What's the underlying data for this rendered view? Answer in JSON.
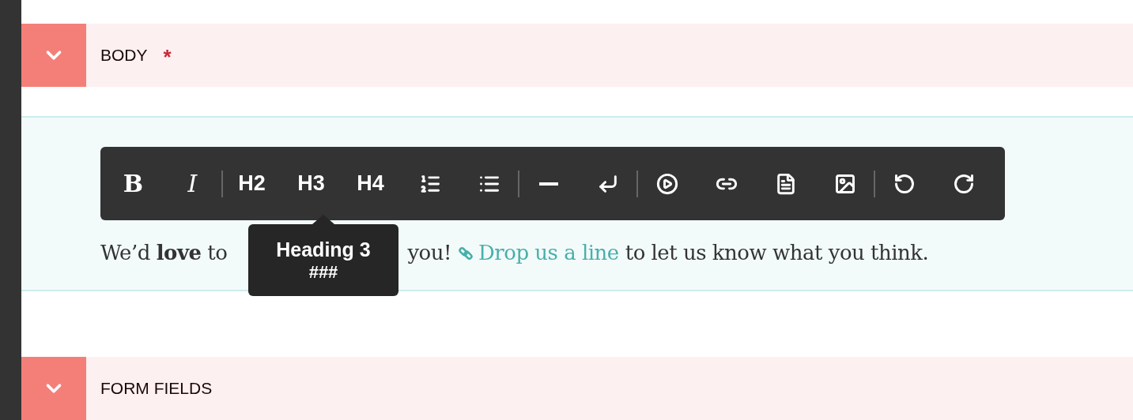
{
  "sections": [
    {
      "title": "BODY",
      "required_mark": "*",
      "expanded": true
    },
    {
      "title": "FORM FIELDS",
      "expanded": true
    }
  ],
  "toolbar": [
    {
      "kind": "bold",
      "label": "B"
    },
    {
      "kind": "italic",
      "label": "I"
    },
    {
      "kind": "separator"
    },
    {
      "kind": "heading",
      "label": "H2"
    },
    {
      "kind": "heading",
      "label": "H3"
    },
    {
      "kind": "heading",
      "label": "H4"
    },
    {
      "kind": "ordered-list"
    },
    {
      "kind": "bullet-list"
    },
    {
      "kind": "separator"
    },
    {
      "kind": "rule"
    },
    {
      "kind": "line-break"
    },
    {
      "kind": "separator"
    },
    {
      "kind": "video"
    },
    {
      "kind": "link"
    },
    {
      "kind": "document"
    },
    {
      "kind": "image"
    },
    {
      "kind": "separator"
    },
    {
      "kind": "undo"
    },
    {
      "kind": "redo"
    }
  ],
  "tooltip": {
    "title": "Heading 3",
    "shortcut": "###"
  },
  "paragraph": [
    {
      "kind": "text",
      "text": "We’d **love** to"
    },
    {
      "kind": "text",
      "text": "you!"
    },
    {
      "kind": "link",
      "text": "Drop us a line"
    },
    {
      "kind": "text",
      "text": "to let us know what you think."
    }
  ]
}
